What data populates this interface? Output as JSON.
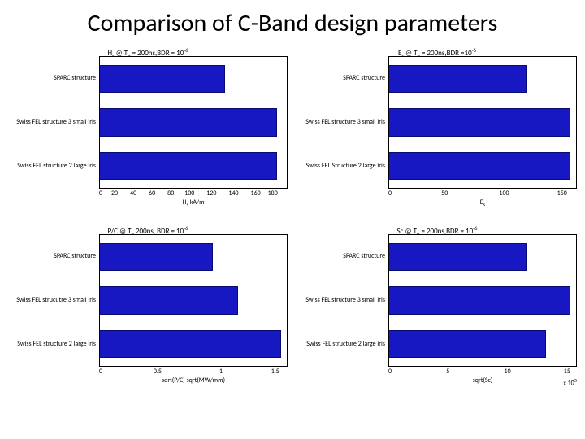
{
  "slide": {
    "title": "Comparison of C-Band design parameters"
  },
  "categories": [
    "SPARC structure",
    "Swiss FEL structure 3 small iris",
    "Swiss FEL structure 2 large iris"
  ],
  "chart_data": [
    {
      "type": "bar",
      "orientation": "horizontal",
      "title_plain": "Hs @ Tp = 200ns,BDR = 10^-6",
      "xlabel": "Hs kA/m",
      "xlim": [
        0,
        180
      ],
      "xticks": [
        0,
        20,
        40,
        60,
        80,
        100,
        120,
        140,
        160,
        180
      ],
      "categories": [
        "SPARC structure",
        "Swiss FEL structure 3 small iris",
        "Swiss FEL structure 2 large iris"
      ],
      "values": [
        120,
        170,
        170
      ]
    },
    {
      "type": "bar",
      "orientation": "horizontal",
      "title_plain": "Es @ Tp = 200ns,BDR =10^-6",
      "xlabel": "Es",
      "xlim": [
        0,
        150
      ],
      "xticks": [
        0,
        50,
        100,
        150
      ],
      "categories": [
        "SPARC structure",
        "Swiss FEL structure 3 small iris",
        "Swiss FEL Structure 2 large iris"
      ],
      "values": [
        110,
        145,
        145
      ]
    },
    {
      "type": "bar",
      "orientation": "horizontal",
      "title_plain": "P/C @ Tp 200ns, BDR = 10^-6",
      "xlabel": "sqrt(P/C) sqrt(MW/mm)",
      "xlim": [
        0,
        1.5
      ],
      "xticks": [
        0,
        0.5,
        1,
        1.5
      ],
      "categories": [
        "SPARC structure",
        "Swiss FEL strucutre 3 small iris",
        "Swiss FEL structure 2 large iris"
      ],
      "values": [
        0.9,
        1.1,
        1.45
      ]
    },
    {
      "type": "bar",
      "orientation": "horizontal",
      "title_plain": "Sc @ Tp = 200ns,BDR = 10^-6",
      "xlabel": "sqrt(Sc)",
      "xlim": [
        0,
        15
      ],
      "xticks": [
        0,
        5,
        10,
        15
      ],
      "x_exponent": "x 10^5",
      "categories": [
        "SPARC structure",
        "Swiss FEL structure 3 small iris",
        "Swiss FEL structure 2 large iris"
      ],
      "values": [
        11,
        14.5,
        12.5
      ]
    }
  ]
}
